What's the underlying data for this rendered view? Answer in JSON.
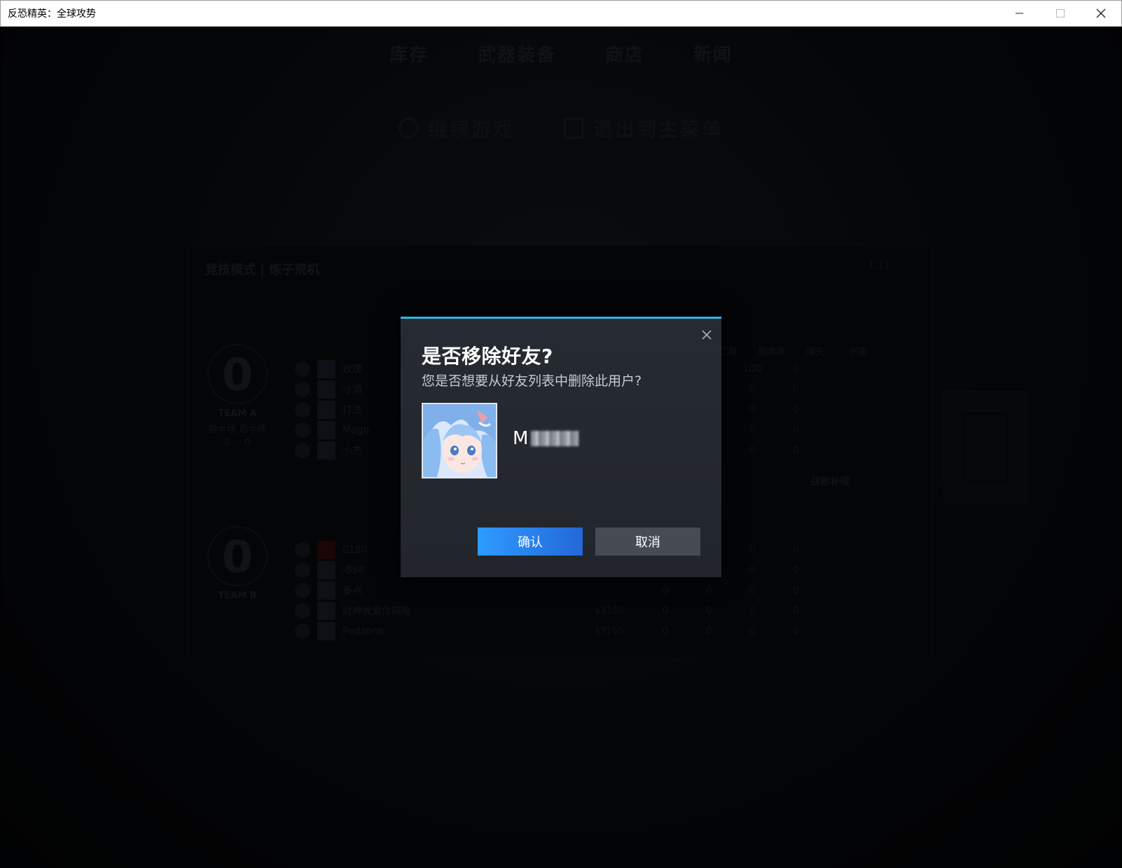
{
  "window": {
    "title": "反恐精英：全球攻势",
    "controls": [
      "minimize-icon",
      "maximize-icon",
      "close-icon"
    ]
  },
  "background": {
    "nav": [
      "库存",
      "武器装备",
      "商店",
      "新闻"
    ],
    "menu": {
      "resume": "继续游戏",
      "exit": "退出到主菜单"
    },
    "scoreboard": {
      "mode": "竞技模式 | 炼子荒机",
      "time": "1:11",
      "team_a": {
        "score": "0",
        "name": "TEAM A",
        "half_first": "0",
        "half_second": "0"
      },
      "team_b": {
        "score": "0",
        "name": "TEAM B"
      },
      "half_labels": [
        "前半场",
        "后半场"
      ],
      "stat_headers": [
        "亡数",
        "助攻数",
        "爆头",
        "伤害"
      ],
      "side_label": "战败补偿",
      "team_a_rows": [
        {
          "name": "玫瑰",
          "stats": [
            "0",
            "0",
            "100",
            "0"
          ]
        },
        {
          "name": "冷酒",
          "stats": [
            "0",
            "0",
            "0",
            "0"
          ]
        },
        {
          "name": "打法",
          "stats": [
            "0",
            "0",
            "0",
            "0"
          ]
        },
        {
          "name": "Mago",
          "stats": [
            "0",
            "0",
            "0",
            "0"
          ]
        },
        {
          "name": "小杰",
          "stats": [
            "0",
            "0",
            "0",
            "0"
          ]
        }
      ],
      "team_b_rows": [
        {
          "name": "0180",
          "stats": [
            "0",
            "0",
            "0",
            "0"
          ]
        },
        {
          "name": "-BSP",
          "stats": [
            "0",
            "1",
            "0",
            "0"
          ]
        },
        {
          "name": "多点",
          "stats": [
            "0",
            "0",
            "0",
            "0"
          ]
        },
        {
          "name": "财神我爱你阿哈",
          "money": "$3150",
          "stats": [
            "0",
            "0",
            "0",
            "0"
          ]
        },
        {
          "name": "Pedzone",
          "money": "$3150",
          "stats": [
            "0",
            "0",
            "0",
            "0"
          ]
        }
      ]
    }
  },
  "dialog": {
    "title": "是否移除好友?",
    "subtitle": "您是否想要从好友列表中删除此用户?",
    "username_visible": "M",
    "confirm_label": "确认",
    "cancel_label": "取消",
    "accent": "#2fb5e6",
    "confirm_color": "#2f80e8",
    "cancel_color": "#464b54"
  }
}
